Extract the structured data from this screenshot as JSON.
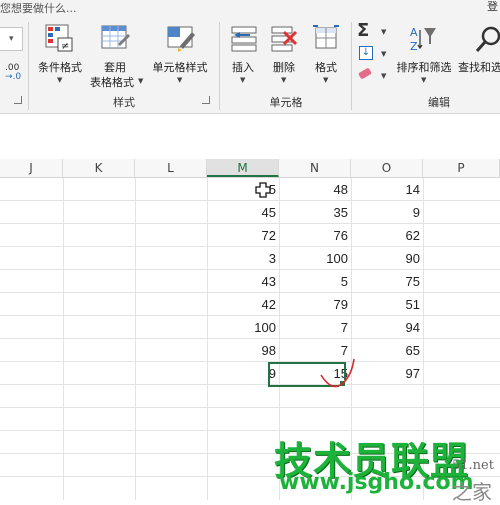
{
  "ribbon": {
    "tell_me": "您想要做什么...",
    "sign_in": "登",
    "groups": {
      "styles": "样式",
      "cells": "单元格",
      "editing": "编辑"
    },
    "buttons": {
      "conditional_format": "条件格式",
      "format_table_1": "套用",
      "format_table_2": "表格格式",
      "cell_styles": "单元格样式",
      "insert": "插入",
      "delete": "删除",
      "format": "格式",
      "sort_filter": "排序和筛选",
      "find_select": "查找和选"
    },
    "number_format_glyph": ".00\n→.0",
    "autosum_glyph": "Σ"
  },
  "sheet": {
    "columns": [
      "J",
      "K",
      "L",
      "M",
      "N",
      "O",
      "P"
    ],
    "selected_column": "M",
    "rows": [
      {
        "M": "5",
        "N": "48",
        "O": "14"
      },
      {
        "M": "45",
        "N": "35",
        "O": "9"
      },
      {
        "M": "72",
        "N": "76",
        "O": "62"
      },
      {
        "M": "3",
        "N": "100",
        "O": "90"
      },
      {
        "M": "43",
        "N": "5",
        "O": "75"
      },
      {
        "M": "42",
        "N": "79",
        "O": "51"
      },
      {
        "M": "100",
        "N": "7",
        "O": "94"
      },
      {
        "M": "98",
        "N": "7",
        "O": "65"
      },
      {
        "M": "9",
        "N": "15",
        "O": "97"
      }
    ]
  },
  "watermark": {
    "title": "技术员联盟",
    "url": "www.jsgho.com",
    "small": "51.net",
    "cn": "之家"
  },
  "colors": {
    "accent": "#217346",
    "watermark": "#1db33a",
    "annotation": "#d9262a"
  }
}
